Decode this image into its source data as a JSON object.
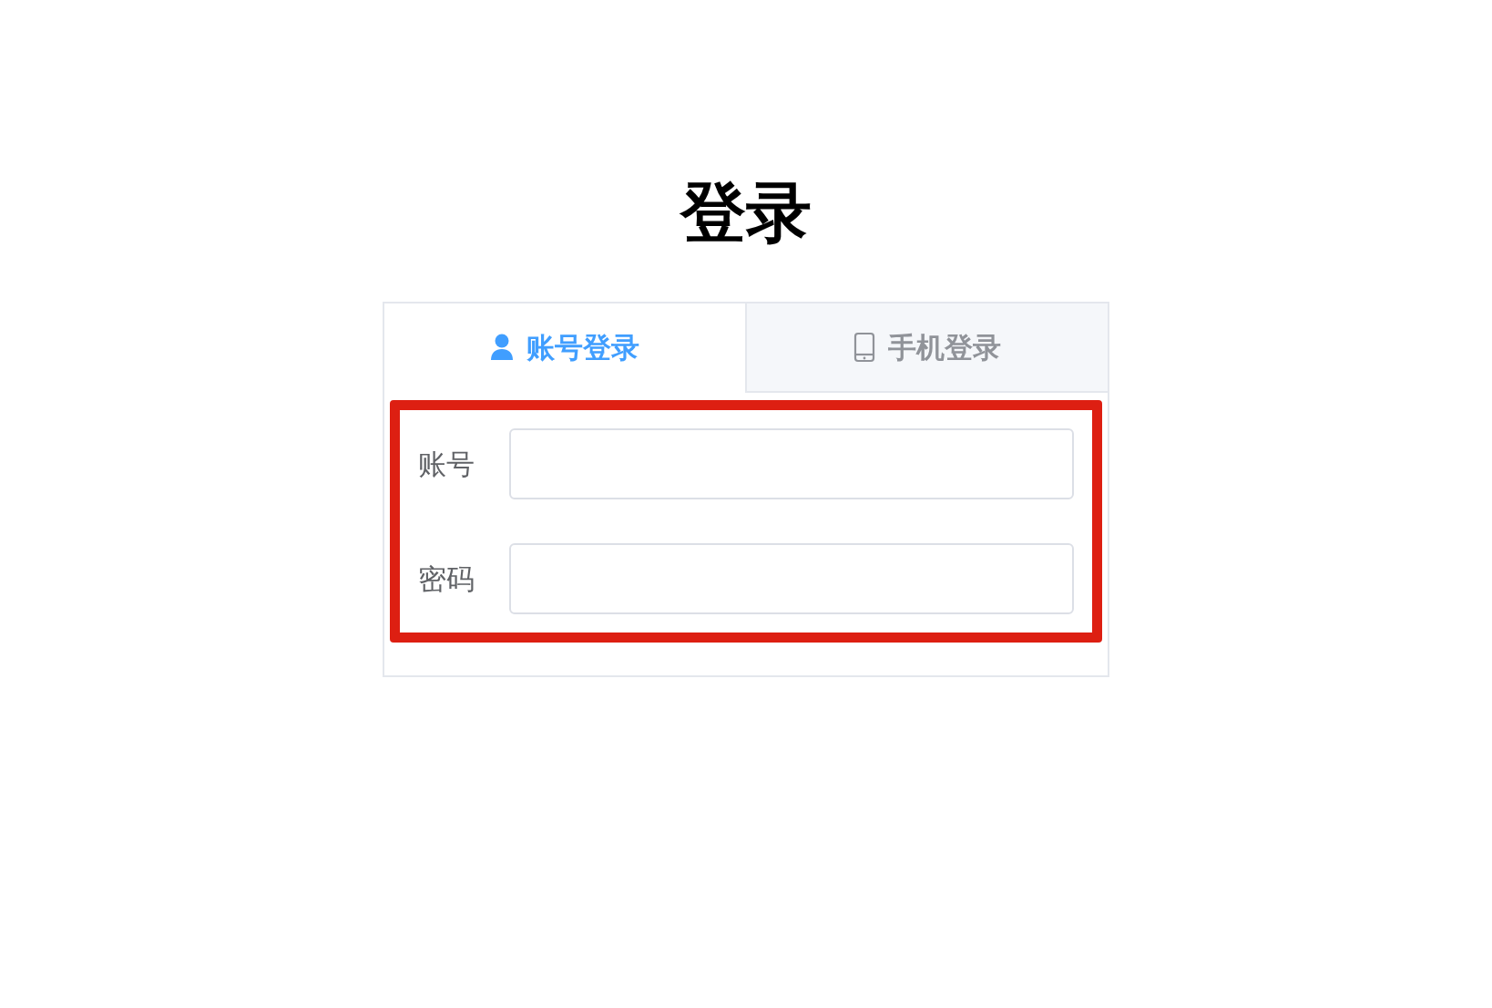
{
  "title": "登录",
  "tabs": [
    {
      "label": "账号登录",
      "kind": "user",
      "selected": true
    },
    {
      "label": "手机登录",
      "kind": "phone",
      "selected": false
    }
  ],
  "fields": [
    {
      "label": "账号"
    },
    {
      "label": "密码"
    }
  ],
  "highlight": {
    "on": true
  }
}
